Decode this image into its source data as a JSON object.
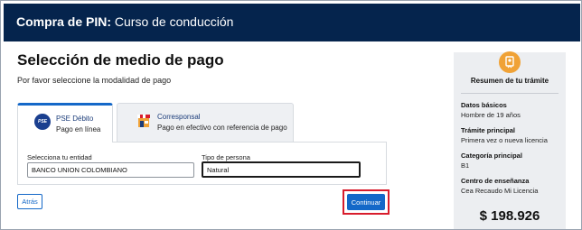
{
  "header": {
    "title_bold": "Compra de PIN:",
    "title_rest": " Curso de conducción",
    "background": "#05244d"
  },
  "page": {
    "title": "Selección de medio de pago",
    "subtitle": "Por favor seleccione la modalidad de pago"
  },
  "payment_tabs": [
    {
      "label": "PSE Débito",
      "description": "Pago en línea",
      "icon": "pse-logo-icon",
      "logo_text": "PSE",
      "active": true
    },
    {
      "label": "Corresponsal",
      "description": "Pago en efectivo con referencia de pago",
      "icon": "storefront-icon",
      "active": false
    }
  ],
  "form": {
    "entity_label": "Selecciona tu entidad",
    "entity_value": "BANCO UNION COLOMBIANO",
    "person_type_label": "Tipo de persona",
    "person_type_value": "Natural"
  },
  "buttons": {
    "back": "Atrás",
    "continue": "Continuar"
  },
  "summary": {
    "icon": "certificate-icon",
    "title": "Resumen de tu trámite",
    "items": [
      {
        "label": "Datos básicos",
        "value": "Hombre de 19 años"
      },
      {
        "label": "Trámite principal",
        "value": "Primera vez o nueva licencia"
      },
      {
        "label": "Categoría principal",
        "value": "B1"
      },
      {
        "label": "Centro de enseñanza",
        "value": "Cea Recaudo Mi Licencia"
      }
    ],
    "total": "$ 198.926"
  },
  "colors": {
    "primary": "#1468c8",
    "highlight": "#d81c2c",
    "summary_icon": "#f0a236"
  }
}
